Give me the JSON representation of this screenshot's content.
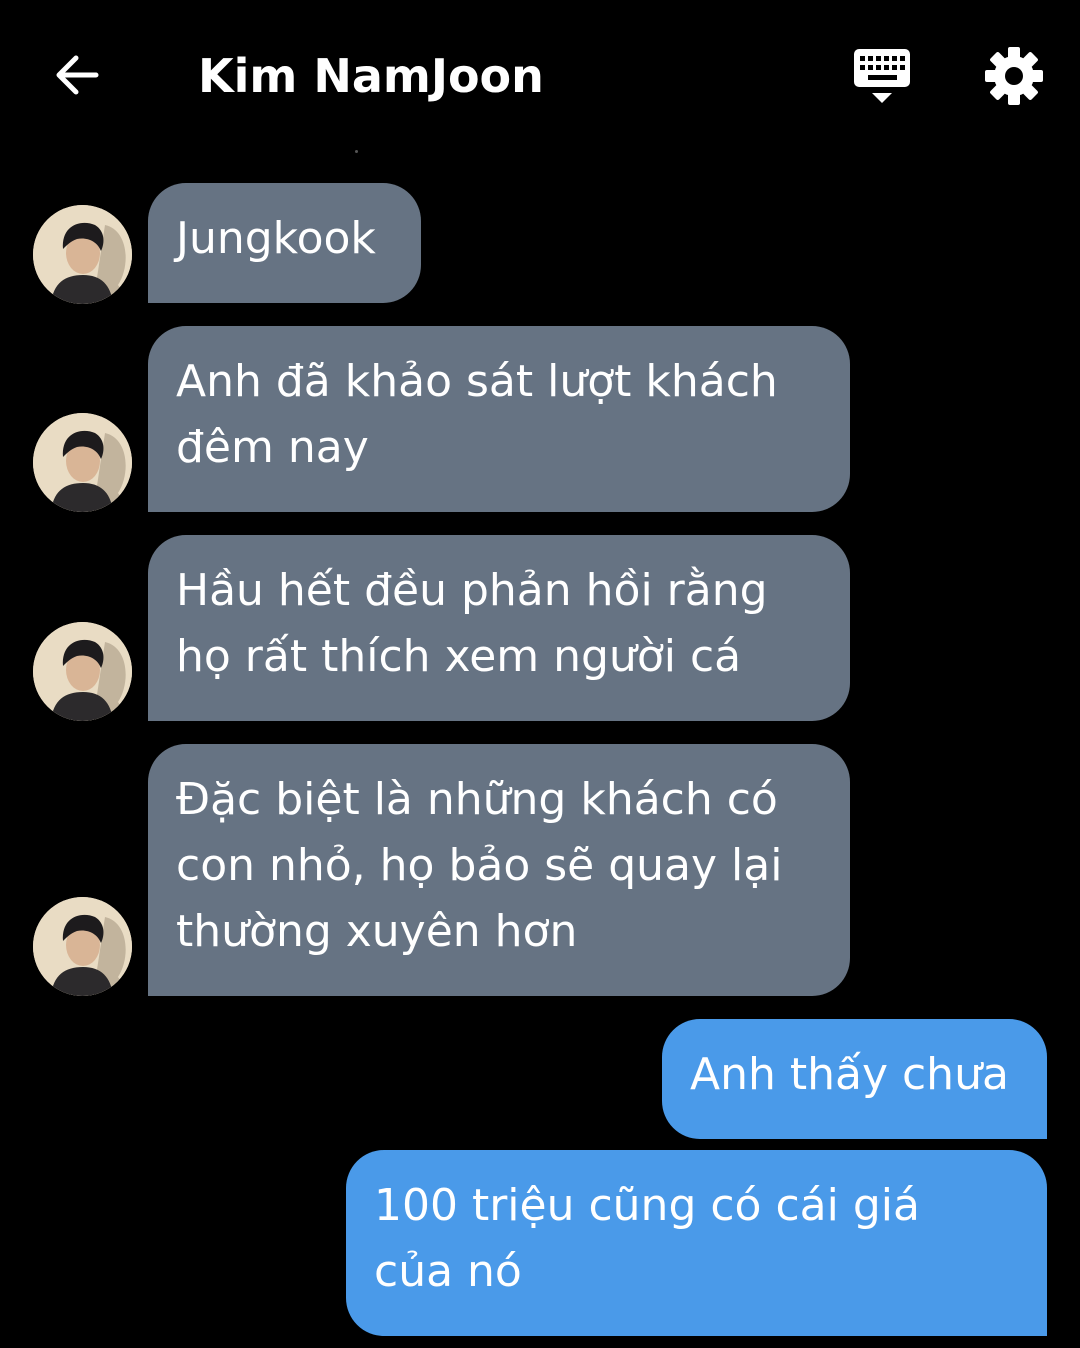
{
  "header": {
    "title": "Kim NamJoon",
    "back_icon": "arrow-left-icon",
    "keyboard_icon": "keyboard-icon",
    "settings_icon": "gear-icon"
  },
  "colors": {
    "background": "#000000",
    "incoming_bubble": "#667383",
    "outgoing_bubble": "#4a9ae9",
    "text": "#ffffff"
  },
  "messages": [
    {
      "sender": "Kim NamJoon",
      "direction": "incoming",
      "lines": [
        "Jungkook"
      ]
    },
    {
      "sender": "Kim NamJoon",
      "direction": "incoming",
      "lines": [
        "Anh đã khảo sát lượt khách",
        "đêm nay"
      ]
    },
    {
      "sender": "Kim NamJoon",
      "direction": "incoming",
      "lines": [
        "Hầu hết đều phản hồi rằng",
        "họ rất thích xem người cá"
      ]
    },
    {
      "sender": "Kim NamJoon",
      "direction": "incoming",
      "lines": [
        "Đặc biệt là những khách có",
        "con nhỏ, họ bảo sẽ quay lại",
        "thường xuyên hơn"
      ]
    },
    {
      "sender": "me",
      "direction": "outgoing",
      "lines": [
        "Anh thấy chưa"
      ]
    },
    {
      "sender": "me",
      "direction": "outgoing",
      "lines": [
        "100 triệu cũng có cái giá",
        "của nó"
      ]
    }
  ]
}
